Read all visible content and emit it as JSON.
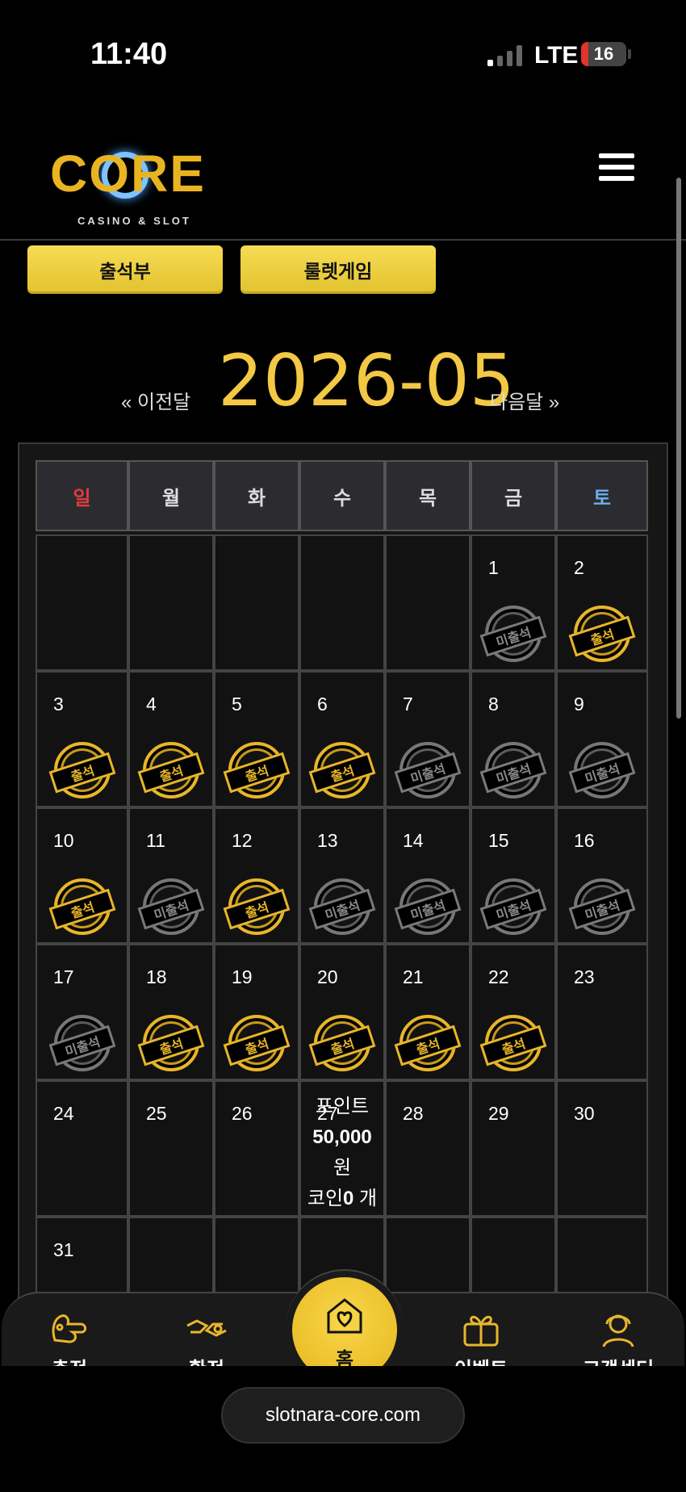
{
  "status_bar": {
    "time": "11:40",
    "network": "LTE",
    "battery": "16"
  },
  "header": {
    "logo_word": "CORE",
    "logo_sub": "CASINO & SLOT"
  },
  "tabs": [
    {
      "label": "출석부"
    },
    {
      "label": "룰렛게임"
    }
  ],
  "month_nav": {
    "prev": "« 이전달",
    "title": "2026-05",
    "next": "다음달 »"
  },
  "calendar": {
    "weekdays": [
      "일",
      "월",
      "화",
      "수",
      "목",
      "금",
      "토"
    ],
    "stamp_labels": {
      "attended": "출석",
      "absent": "미출석"
    },
    "days": {
      "1": "absent",
      "2": "attended",
      "3": "attended",
      "4": "attended",
      "5": "attended",
      "6": "attended",
      "7": "absent",
      "8": "absent",
      "9": "absent",
      "10": "attended",
      "11": "absent",
      "12": "attended",
      "13": "absent",
      "14": "absent",
      "15": "absent",
      "16": "absent",
      "17": "absent",
      "18": "attended",
      "19": "attended",
      "20": "attended",
      "21": "attended",
      "22": "attended",
      "23": "",
      "24": "",
      "25": "",
      "26": "",
      "27": "",
      "28": "",
      "29": "",
      "30": "",
      "31": ""
    },
    "point_cell": {
      "day": "27",
      "label": "포인트",
      "amount": "50,000",
      "unit": "원",
      "coin_label": "코인",
      "coin_value": "0",
      "coin_unit": " 개"
    }
  },
  "bottom_nav": {
    "items": [
      {
        "label": "충전",
        "icon": "charge-icon"
      },
      {
        "label": "환전",
        "icon": "exchange-icon"
      },
      {
        "label": "홈",
        "icon": "home-heart-icon"
      },
      {
        "label": "이벤트",
        "icon": "gift-icon"
      },
      {
        "label": "고객센터",
        "icon": "headset-icon"
      }
    ]
  },
  "browser": {
    "url": "slotnara-core.com"
  },
  "colors": {
    "accent": "#f3c844",
    "sunday": "#e23b3b",
    "saturday": "#6ab0f0",
    "stamp_gold": "#e8b62a",
    "stamp_gray": "#7a7a7a"
  }
}
